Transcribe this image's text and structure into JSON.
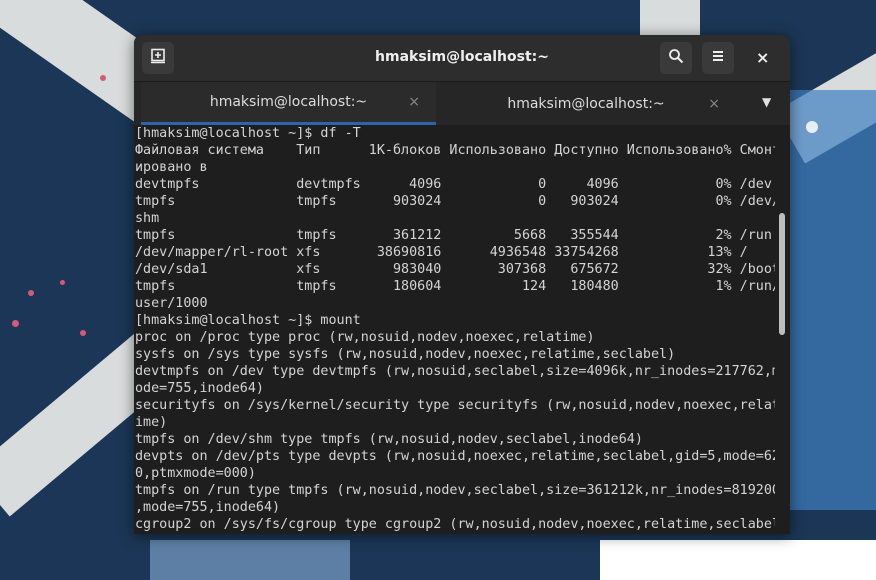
{
  "window": {
    "title": "hmaksim@localhost:~",
    "new_tab_icon": "new-tab-icon",
    "search_icon": "search-icon",
    "menu_icon": "hamburger-menu-icon",
    "close_label": "×"
  },
  "tabs": [
    {
      "label": "hmaksim@localhost:~",
      "close": "×",
      "active": true
    },
    {
      "label": "hmaksim@localhost:~",
      "close": "×",
      "active": false
    }
  ],
  "tabs_menu": "▼",
  "terminal": {
    "lines": [
      "[hmaksim@localhost ~]$ df -T",
      "Файловая система    Тип      1K-блоков Использовано Доступно Использовано% Смонт",
      "ировано в",
      "devtmpfs            devtmpfs      4096            0     4096            0% /dev",
      "tmpfs               tmpfs       903024            0   903024            0% /dev/",
      "shm",
      "tmpfs               tmpfs       361212         5668   355544            2% /run",
      "/dev/mapper/rl-root xfs       38690816      4936548 33754268           13% /",
      "/dev/sda1           xfs         983040       307368   675672           32% /boot",
      "tmpfs               tmpfs       180604          124   180480            1% /run/",
      "user/1000",
      "[hmaksim@localhost ~]$ mount",
      "proc on /proc type proc (rw,nosuid,nodev,noexec,relatime)",
      "sysfs on /sys type sysfs (rw,nosuid,nodev,noexec,relatime,seclabel)",
      "devtmpfs on /dev type devtmpfs (rw,nosuid,seclabel,size=4096k,nr_inodes=217762,m",
      "ode=755,inode64)",
      "securityfs on /sys/kernel/security type securityfs (rw,nosuid,nodev,noexec,relat",
      "ime)",
      "tmpfs on /dev/shm type tmpfs (rw,nosuid,nodev,seclabel,inode64)",
      "devpts on /dev/pts type devpts (rw,nosuid,noexec,relatime,seclabel,gid=5,mode=62",
      "0,ptmxmode=000)",
      "tmpfs on /run type tmpfs (rw,nosuid,nodev,seclabel,size=361212k,nr_inodes=819200",
      ",mode=755,inode64)",
      "cgroup2 on /sys/fs/cgroup type cgroup2 (rw,nosuid,nodev,noexec,relatime,seclabel"
    ]
  },
  "colors": {
    "accent": "#2f63ad",
    "terminal_bg": "#1e1e1e",
    "desktop_bg": "#1b3656"
  }
}
